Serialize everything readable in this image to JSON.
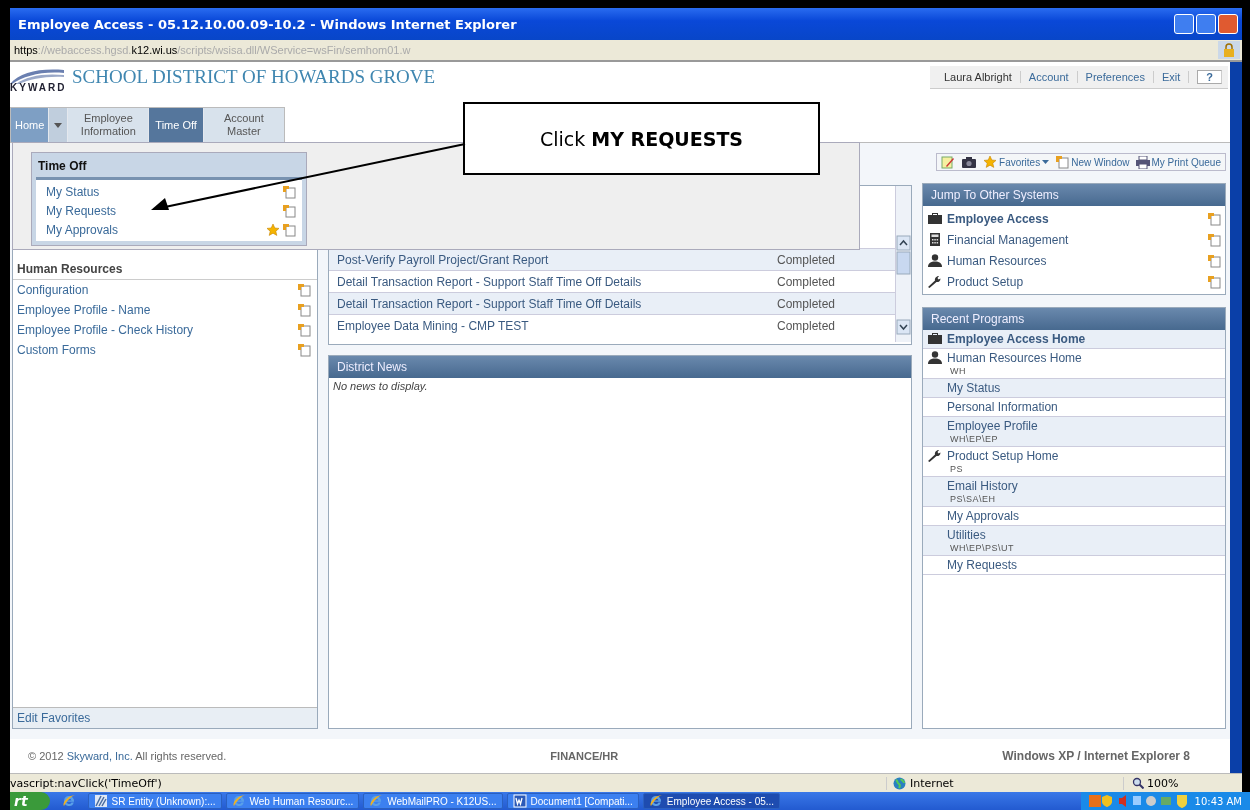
{
  "window": {
    "title": "Employee Access - 05.12.10.00.09-10.2 - Windows Internet Explorer"
  },
  "address": [
    {
      "text": "https",
      "strong": true
    },
    {
      "text": "://webaccess.hgsd.",
      "strong": false
    },
    {
      "text": "k12.wi.us",
      "strong": true
    },
    {
      "text": "/scripts/wsisa.dll/WService=wsFin/semhom01.w",
      "strong": false
    }
  ],
  "header": {
    "logo_text": "KYWARD",
    "district": "SCHOOL DISTRICT OF HOWARDS GROVE",
    "user": "Laura Albright",
    "links": [
      "Account",
      "Preferences",
      "Exit"
    ],
    "help": "?"
  },
  "nav_tabs": [
    {
      "label": "Home",
      "kind": "home",
      "selected": false
    },
    {
      "label": "Employee Information",
      "kind": "menu",
      "selected": false
    },
    {
      "label": "Time Off",
      "kind": "menu",
      "selected": true
    },
    {
      "label": "Account Master",
      "kind": "menu",
      "selected": false
    }
  ],
  "toolbar": {
    "favorites": "Favorites",
    "new_window": "New Window",
    "print_queue": "My Print Queue"
  },
  "dropdown": {
    "title": "Time Off",
    "items": [
      {
        "label": "My Status",
        "favorite": false
      },
      {
        "label": "My Requests",
        "favorite": false
      },
      {
        "label": "My Approvals",
        "favorite": true
      }
    ]
  },
  "callout": {
    "text": "Click **MY REQUESTS**"
  },
  "favorites": {
    "group": "Human Resources",
    "items": [
      "Configuration",
      "Employee Profile - Name",
      "Employee Profile - Check History",
      "Custom Forms"
    ],
    "footer": "Edit Favorites"
  },
  "reports": {
    "rows": [
      {
        "name": "Post-Verify Payroll Project/Grant Report",
        "status": "Completed"
      },
      {
        "name": "Detail Transaction Report - Support Staff Time Off Details",
        "status": "Completed"
      },
      {
        "name": "Detail Transaction Report - Support Staff Time Off Details",
        "status": "Completed"
      },
      {
        "name": "Employee Data Mining - CMP TEST",
        "status": "Completed"
      }
    ]
  },
  "news": {
    "title": "District News",
    "empty": "No news to display."
  },
  "jump": {
    "title": "Jump To Other Systems",
    "items": [
      {
        "label": "Employee Access",
        "kind": "briefcase",
        "current": true
      },
      {
        "label": "Financial Management",
        "kind": "calculator",
        "current": false
      },
      {
        "label": "Human Resources",
        "kind": "person",
        "current": false
      },
      {
        "label": "Product Setup",
        "kind": "wrench",
        "current": false
      }
    ]
  },
  "recent": {
    "title": "Recent Programs",
    "items": [
      {
        "label": "Employee Access Home",
        "kind": "briefcase",
        "current": true
      },
      {
        "label": "Human Resources Home",
        "code": "WH",
        "kind": "person",
        "current": false
      },
      {
        "label": "My Status",
        "current": false
      },
      {
        "label": "Personal Information",
        "current": false
      },
      {
        "label": "Employee Profile",
        "code": "WH\\EP\\EP",
        "current": false
      },
      {
        "label": "Product Setup Home",
        "code": "PS",
        "kind": "wrench",
        "current": false
      },
      {
        "label": "Email History",
        "code": "PS\\SA\\EH",
        "current": false
      },
      {
        "label": "My Approvals",
        "current": false
      },
      {
        "label": "Utilities",
        "code": "WH\\EP\\PS\\UT",
        "current": false
      },
      {
        "label": "My Requests",
        "current": false
      }
    ]
  },
  "footer": {
    "copyright_prefix": "© 2012",
    "company": "Skyward, Inc.",
    "copyright_suffix": "All rights reserved.",
    "center": "FINANCE/HR",
    "right": "Windows XP / Internet Explorer 8"
  },
  "status_bar": {
    "text": "vascript:navClick('TimeOff')",
    "zone": "Internet",
    "zoom": "100%"
  },
  "taskbar": {
    "start": "rt",
    "tasks": [
      {
        "label": "SR Entity (Unknown):...",
        "kind": "app",
        "selected": false
      },
      {
        "label": "Web Human Resourc...",
        "kind": "ie",
        "selected": false
      },
      {
        "label": "WebMailPRO - K12US...",
        "kind": "ie",
        "selected": false
      },
      {
        "label": "Document1 [Compati...",
        "kind": "word",
        "selected": false
      },
      {
        "label": "Employee Access - 05...",
        "kind": "ie",
        "selected": true
      }
    ],
    "clock": "10:43 AM"
  }
}
